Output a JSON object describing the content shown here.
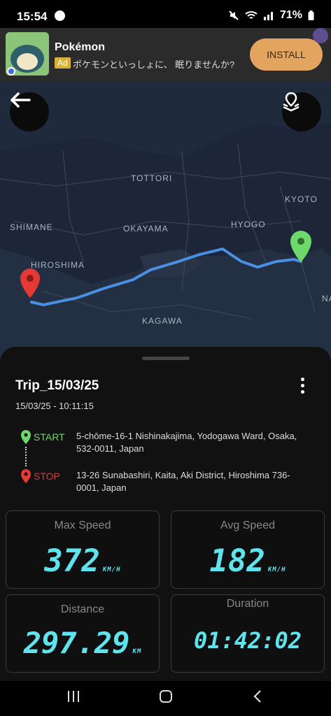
{
  "status": {
    "time": "15:54",
    "battery": "71%"
  },
  "ad": {
    "title": "Pokémon",
    "tag": "Ad",
    "description": "ポケモンといっしょに、 眠りませんか?",
    "install_label": "INSTALL"
  },
  "map": {
    "labels": [
      "TOTTORI",
      "KYOTO",
      "SHIMANE",
      "OKAYAMA",
      "HYOGO",
      "HIROSHIMA",
      "KAGAWA",
      "NA"
    ]
  },
  "trip": {
    "title": "Trip_15/03/25",
    "datetime": "15/03/25 - 10:11:15",
    "start_label": "START",
    "start_address": "5-chōme-16-1 Nishinakajima, Yodogawa Ward, Osaka, 532-0011, Japan",
    "stop_label": "STOP",
    "stop_address": "13-26 Sunabashiri, Kaita, Aki District, Hiroshima 736-0001, Japan"
  },
  "stats": {
    "max_speed": {
      "label": "Max Speed",
      "value": "372",
      "unit": "KM/H"
    },
    "avg_speed": {
      "label": "Avg Speed",
      "value": "182",
      "unit": "KM/H"
    },
    "distance": {
      "label": "Distance",
      "value": "297.29",
      "unit": "KM"
    },
    "duration": {
      "label": "Duration",
      "value": "01:42:02"
    }
  },
  "colors": {
    "accent": "#5fe4ee",
    "start": "#6cd96a",
    "stop": "#e53935",
    "route": "#4a90e2"
  }
}
